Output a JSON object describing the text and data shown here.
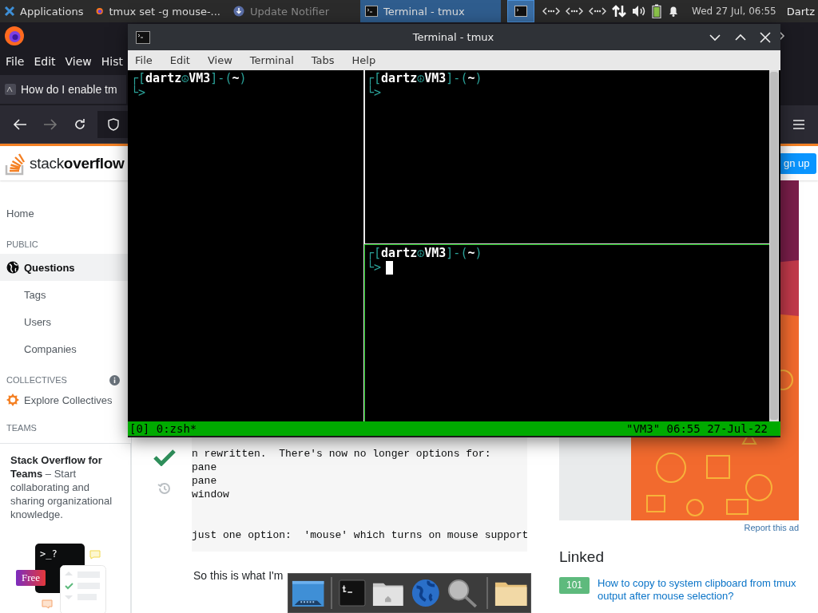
{
  "panel": {
    "apps_label": "Applications",
    "clock": "Wed 27 Jul, 06:55",
    "user": "Dartz",
    "tasks": [
      {
        "label": "tmux set -g mouse-...",
        "kind": "browser",
        "selected": false,
        "disabled": false
      },
      {
        "label": "Update Notifier",
        "kind": "updater",
        "selected": false,
        "disabled": true
      },
      {
        "label": "Terminal - tmux",
        "kind": "terminal",
        "selected": true,
        "disabled": false
      }
    ]
  },
  "browser": {
    "menu": [
      "File",
      "Edit",
      "View",
      "Hist"
    ],
    "tab_title": "How do I enable tm",
    "logo": "stack**overflow**",
    "signup": "gn up"
  },
  "sidebar": {
    "items": [
      {
        "kind": "link",
        "label": "Home",
        "selected": false
      },
      {
        "kind": "heading",
        "label": "PUBLIC",
        "info": false
      },
      {
        "kind": "main",
        "label": "Questions",
        "selected": true
      },
      {
        "kind": "sub",
        "label": "Tags",
        "selected": false
      },
      {
        "kind": "sub",
        "label": "Users",
        "selected": false
      },
      {
        "kind": "sub",
        "label": "Companies",
        "selected": false
      },
      {
        "kind": "heading",
        "label": "COLLECTIVES",
        "info": true
      },
      {
        "kind": "collective",
        "label": "Explore Collectives",
        "selected": false
      },
      {
        "kind": "heading",
        "label": "TEAMS",
        "info": false
      }
    ],
    "teams_card": {
      "text": "**Stack Overflow for Teams** – Start collaborating and sharing organizational knowledge.",
      "prompt": ">_?",
      "badge": "Free"
    }
  },
  "answer": {
    "accepted": true,
    "code": "n rewritten.  There's now no longer options for:\npane\npane\nwindow\n\n\njust one option:  'mouse' which turns on mouse support",
    "text": "So this is what I'm"
  },
  "right": {
    "report": "Report this ad",
    "linked_title": "Linked",
    "linked": [
      {
        "score": "101",
        "title": "How to copy to system clipboard from tmux output after mouse selection?"
      }
    ]
  },
  "terminal": {
    "title": "Terminal - tmux",
    "menu": [
      "File",
      "Edit",
      "View",
      "Terminal",
      "Tabs",
      "Help"
    ],
    "panes": [
      {
        "prompt": [
          {
            "text": "┌[",
            "kind": "frame"
          },
          {
            "text": "dartz",
            "kind": "name"
          },
          {
            "text": "☮",
            "kind": "frame"
          },
          {
            "text": "VM3",
            "kind": "name"
          },
          {
            "text": "]-(",
            "kind": "frame"
          },
          {
            "text": "~",
            "kind": "name"
          },
          {
            "text": ")",
            "kind": "frame"
          }
        ],
        "arrow": "└>",
        "cursor": false,
        "active": false
      },
      {
        "prompt": [
          {
            "text": "┌[",
            "kind": "frame"
          },
          {
            "text": "dartz",
            "kind": "name"
          },
          {
            "text": "☮",
            "kind": "frame"
          },
          {
            "text": "VM3",
            "kind": "name"
          },
          {
            "text": "]-(",
            "kind": "frame"
          },
          {
            "text": "~",
            "kind": "name"
          },
          {
            "text": ")",
            "kind": "frame"
          }
        ],
        "arrow": "└>",
        "cursor": false,
        "active": false
      },
      {
        "prompt": [
          {
            "text": "┌[",
            "kind": "frame"
          },
          {
            "text": "dartz",
            "kind": "name"
          },
          {
            "text": "☮",
            "kind": "frame"
          },
          {
            "text": "VM3",
            "kind": "name"
          },
          {
            "text": "]-(",
            "kind": "frame"
          },
          {
            "text": "~",
            "kind": "name"
          },
          {
            "text": ")",
            "kind": "frame"
          }
        ],
        "arrow": "└>",
        "cursor": true,
        "active": true
      }
    ],
    "status_left": "[0] 0:zsh*",
    "status_right": "\"VM3\" 06:55 27-Jul-22"
  }
}
